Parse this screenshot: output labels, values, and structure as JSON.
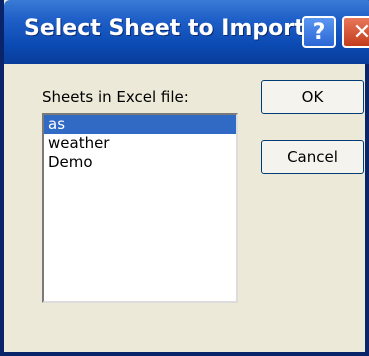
{
  "dialog": {
    "title": "Select Sheet to Import",
    "help_glyph": "?",
    "close_glyph": "✕",
    "list_label": "Sheets in Excel file:",
    "sheets": [
      {
        "label": "as",
        "selected": true
      },
      {
        "label": "weather",
        "selected": false
      },
      {
        "label": "Demo",
        "selected": false
      }
    ],
    "ok_label": "OK",
    "cancel_label": "Cancel"
  },
  "colors": {
    "titlebar": "#0b4ab3",
    "selection": "#316ac5",
    "face": "#ece9d8",
    "close": "#c23c1c"
  }
}
